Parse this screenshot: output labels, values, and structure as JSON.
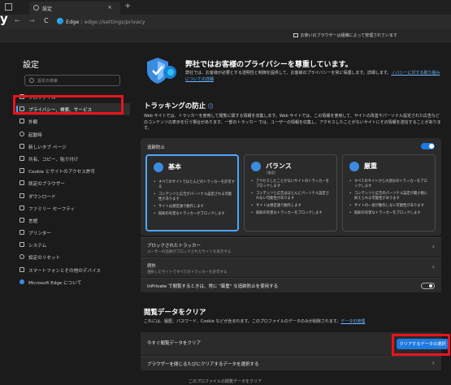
{
  "browser": {
    "tab_title": "設定",
    "new_tab": "+",
    "tab_close": "×",
    "back": "←",
    "forward": "→",
    "refresh": "C",
    "address_brand": "Edge",
    "address_path": "edge://settings/privacy",
    "corner_glyph": "y"
  },
  "banner": {
    "text": "お使いのブラウザーは組織によって管理されています"
  },
  "sidebar": {
    "title": "設定",
    "search_placeholder": "設定の検索",
    "items": [
      {
        "label": "プロファイル",
        "icon": "profile-icon"
      },
      {
        "label": "プライバシー、検索、サービス",
        "icon": "lock-icon",
        "active": true
      },
      {
        "label": "外観",
        "icon": "appearance-icon"
      },
      {
        "label": "起動時",
        "icon": "power-icon"
      },
      {
        "label": "新しいタブ ページ",
        "icon": "newtab-icon"
      },
      {
        "label": "共有、コピー、貼り付け",
        "icon": "share-icon"
      },
      {
        "label": "Cookie とサイトのアクセス許可",
        "icon": "cookie-icon"
      },
      {
        "label": "既定のブラウザー",
        "icon": "browser-icon"
      },
      {
        "label": "ダウンロード",
        "icon": "download-icon"
      },
      {
        "label": "ファミリー セーフティ",
        "icon": "family-icon"
      },
      {
        "label": "言語",
        "icon": "language-icon"
      },
      {
        "label": "プリンター",
        "icon": "printer-icon"
      },
      {
        "label": "システム",
        "icon": "system-icon"
      },
      {
        "label": "設定のリセット",
        "icon": "reset-icon"
      },
      {
        "label": "スマートフォンとその他のデバイス",
        "icon": "phone-icon"
      },
      {
        "label": "Microsoft Edge について",
        "icon": "edge-icon"
      }
    ]
  },
  "hero": {
    "title": "弊社ではお客様のプライバシーを尊重しています。",
    "desc": "弊社では、お客様が必要とする透明性と制御を提供して、お客様のプライバシーを常に保護します。詳細します。",
    "link": "ノバシーに対する取り組みについての詳細"
  },
  "tracking": {
    "heading": "トラッキングの防止",
    "info": "ⓘ",
    "desc": "Web サイトでは、トラッカーを使用して閲覧に関する情報を収集します。Web サイトでは、この情報を使用して、サイトの改善やパーソナル設定された広告などのコンテンツの表示を行う場合があります。一部のトラッカー では、ユーザーの情報を収集し、アクセスしたことがないサイトにその情報を送信することがあります。",
    "card_label": "追跡防止",
    "options": [
      {
        "name": "基本",
        "sub": "",
        "bullets": [
          "すべてのサイトでほとんどのトラッカーを許可する",
          "コンテンツと広告がパーソナル設定される可能性があります",
          "サイトは想定通り動作します",
          "既知の有害なトラッカーがブロックします"
        ]
      },
      {
        "name": "バランス",
        "sub": "(推奨)",
        "bullets": [
          "アクセスしたことがないサイトのトラッカーをブロックします",
          "コンテンツと広告はほとんどパーソナル設定されない可能性があります",
          "サイトは想定通り動作します",
          "既知の有害なトラッカーをブロックします"
        ]
      },
      {
        "name": "厳重",
        "sub": "",
        "bullets": [
          "すべてのサイトから大部分のトラッカーをブロックします",
          "コンテンツと広告のパーソナル設定が最小限に抑えられる可能性があります",
          "サイトの一部が動作しない可能性があります",
          "既知の有害なトラッカーをブロックします"
        ]
      }
    ],
    "blocked_title": "ブロックされたトラッカー",
    "blocked_sub": "ユーザーの追跡がブロックされたサイトを表示する",
    "exceptions_title": "例外",
    "exceptions_sub": "選択したサイトですべてのトラッカーを許可する",
    "inprivate_title": "InPrivate で閲覧するときは、常に \"厳重\" な追跡防止を使用する"
  },
  "clear": {
    "heading": "閲覧データをクリア",
    "desc": "これには、履歴、パスワード、Cookie などが含まれます。このプロファイルのデータのみが削除されます。",
    "desc_link": "データの管理",
    "now_title": "今すぐ閲覧データをクリア",
    "button": "クリアするデータの選択",
    "on_close_title": "ブラウザーを閉じるたびにクリアするデータを選択する"
  },
  "bottom_note": "このプロファイルの閲覧データをクリア",
  "colors": {
    "accent": "#1f7ae0",
    "highlight_box": "#e8141c",
    "bg": "#1b1b1b",
    "card": "#2b2b2b"
  }
}
